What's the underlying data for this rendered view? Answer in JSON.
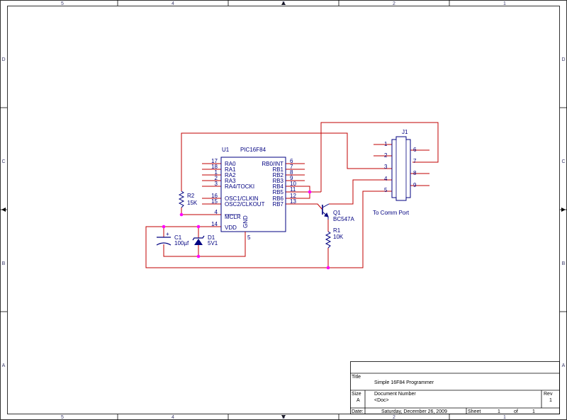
{
  "border": {
    "columns": [
      "5",
      "4",
      "3",
      "2",
      "1"
    ],
    "rows": [
      "D",
      "C",
      "B",
      "A"
    ]
  },
  "components": {
    "u1": {
      "ref": "U1",
      "value": "PIC16F84",
      "left_pins": [
        {
          "num": "17",
          "name": "RA0"
        },
        {
          "num": "18",
          "name": "RA1"
        },
        {
          "num": "1",
          "name": "RA2"
        },
        {
          "num": "2",
          "name": "RA3"
        },
        {
          "num": "3",
          "name": "RA4/TOCKI"
        },
        {
          "num": "16",
          "name": "OSC1/CLKIN"
        },
        {
          "num": "15",
          "name": "OSC2/CLKOUT"
        },
        {
          "num": "4",
          "name": "MCLR"
        },
        {
          "num": "14",
          "name": "VDD"
        }
      ],
      "right_pins": [
        {
          "num": "6",
          "name": "RB0/INT"
        },
        {
          "num": "7",
          "name": "RB1"
        },
        {
          "num": "8",
          "name": "RB2"
        },
        {
          "num": "9",
          "name": "RB3"
        },
        {
          "num": "10",
          "name": "RB4"
        },
        {
          "num": "11",
          "name": "RB5"
        },
        {
          "num": "12",
          "name": "RB6"
        },
        {
          "num": "13",
          "name": "RB7"
        }
      ],
      "gnd_pin": {
        "num": "5",
        "name": "GND"
      }
    },
    "r2": {
      "ref": "R2",
      "value": "15K"
    },
    "c1": {
      "ref": "C1",
      "value": "100µf",
      "plus": "+"
    },
    "d1": {
      "ref": "D1",
      "value": "5V1"
    },
    "q1": {
      "ref": "Q1",
      "value": "BC547A"
    },
    "r1": {
      "ref": "R1",
      "value": "10K"
    },
    "j1": {
      "ref": "J1",
      "label": "To Comm Port",
      "left_pins": [
        "1",
        "2",
        "3",
        "4",
        "5"
      ],
      "right_pins": [
        "6",
        "7",
        "8",
        "9"
      ]
    }
  },
  "title_block": {
    "title_label": "Title",
    "title": "Simple 16F84 Programmer",
    "size_label": "Size",
    "size": "A",
    "docnum_label": "Document Number",
    "docnum": "<Doc>",
    "rev_label": "Rev",
    "rev": "1",
    "date_label": "Date:",
    "date": "Saturday, December 26, 2009",
    "sheet_label": "Sheet",
    "sheet": "1",
    "of_label": "of",
    "sheets": "1"
  },
  "colors": {
    "wire": "#c00000",
    "part": "#000080",
    "junction": "#ff00ff",
    "border": "#000000"
  }
}
